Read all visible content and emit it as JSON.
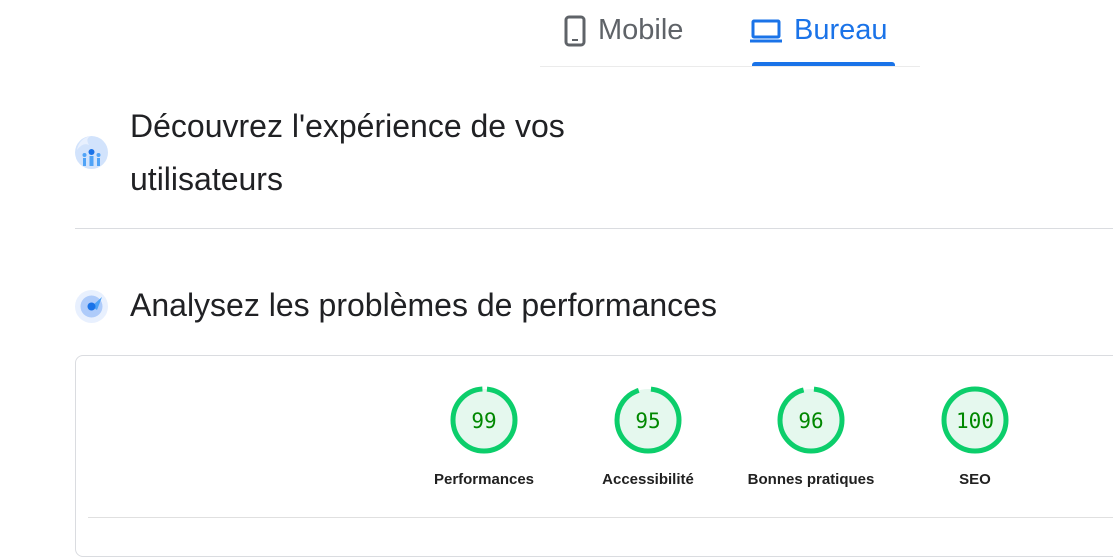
{
  "tabs": {
    "mobile": "Mobile",
    "desktop": "Bureau",
    "active": "desktop"
  },
  "sections": [
    {
      "title_line1": "Découvrez l'expérience de vos",
      "title_line2": "utilisateurs",
      "icon": "users-icon"
    },
    {
      "title": "Analysez les problèmes de performances",
      "icon": "radar-icon"
    }
  ],
  "scores": [
    {
      "label": "Performances",
      "value": 99
    },
    {
      "label": "Accessibilité",
      "value": 95
    },
    {
      "label": "Bonnes pratiques",
      "value": 96
    },
    {
      "label": "SEO",
      "value": 100
    }
  ],
  "colors": {
    "accent": "#1a73e8",
    "pass": "#0cce6b",
    "pass_bg": "#e5f8ee",
    "pass_text": "#008800"
  }
}
